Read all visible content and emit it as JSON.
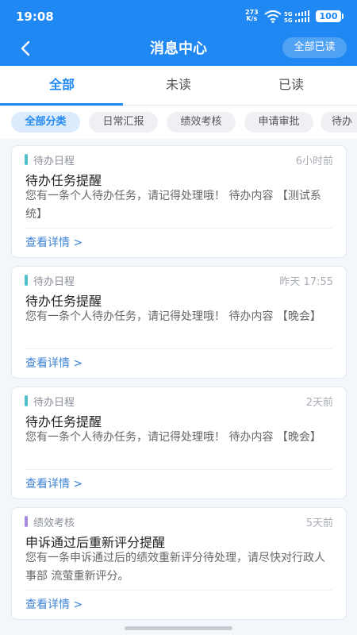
{
  "status_bar": {
    "time": "19:08",
    "speed_value": "273",
    "speed_unit": "K/s",
    "battery": "100"
  },
  "header": {
    "title": "消息中心",
    "mark_all_read": "全部已读"
  },
  "tabs": [
    {
      "label": "全部",
      "active": true
    },
    {
      "label": "未读",
      "active": false
    },
    {
      "label": "已读",
      "active": false
    }
  ],
  "filters": [
    {
      "label": "全部分类",
      "active": true
    },
    {
      "label": "日常汇报",
      "active": false
    },
    {
      "label": "绩效考核",
      "active": false
    },
    {
      "label": "申请审批",
      "active": false
    },
    {
      "label": "待办",
      "active": false
    }
  ],
  "messages": [
    {
      "category": "待办日程",
      "category_color": "#4fbfd0",
      "time": "6小时前",
      "title": "待办任务提醒",
      "body": "您有一条个人待办任务，请记得处理哦！ 待办内容 【测试系统】",
      "link": "查看详情 >"
    },
    {
      "category": "待办日程",
      "category_color": "#4fbfd0",
      "time": "昨天 17:55",
      "title": "待办任务提醒",
      "body": "您有一条个人待办任务，请记得处理哦！ 待办内容 【晚会】",
      "link": "查看详情 >"
    },
    {
      "category": "待办日程",
      "category_color": "#4fbfd0",
      "time": "2天前",
      "title": "待办任务提醒",
      "body": "您有一条个人待办任务，请记得处理哦！ 待办内容 【晚会】",
      "link": "查看详情 >"
    },
    {
      "category": "绩效考核",
      "category_color": "#a98ae0",
      "time": "5天前",
      "title": "申诉通过后重新评分提醒",
      "body": "您有一条申诉通过后的绩效重新评分待处理，请尽快对行政人事部 流萤重新评分。",
      "link": "查看详情 >"
    }
  ],
  "theme": {
    "primary": "#1f88f2"
  }
}
